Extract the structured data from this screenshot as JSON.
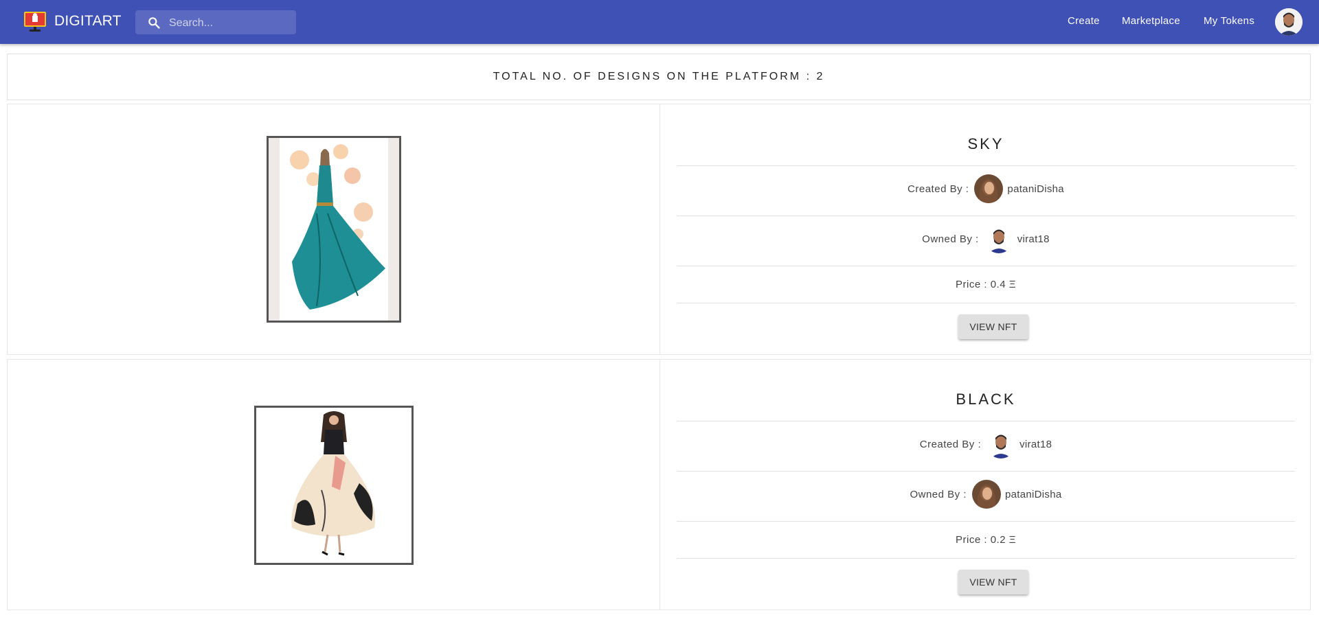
{
  "app": {
    "brand": "DIGITART"
  },
  "header": {
    "search_placeholder": "Search...",
    "nav": [
      "Create",
      "Marketplace",
      "My Tokens"
    ]
  },
  "banner": {
    "text": "TOTAL NO. OF DESIGNS ON THE PLATFORM : 2"
  },
  "designs": [
    {
      "title": "SKY",
      "created_label": "Created By :",
      "creator": "pataniDisha",
      "owned_label": "Owned By :",
      "owner": "virat18",
      "price": "Price : 0.4 Ξ",
      "button": "VIEW NFT"
    },
    {
      "title": "BLACK",
      "created_label": "Created By :",
      "creator": "virat18",
      "owned_label": "Owned By :",
      "owner": "pataniDisha",
      "price": "Price : 0.2 Ξ",
      "button": "VIEW NFT"
    }
  ],
  "colors": {
    "appbar": "#3f51b5",
    "button": "#e0e0e0"
  }
}
